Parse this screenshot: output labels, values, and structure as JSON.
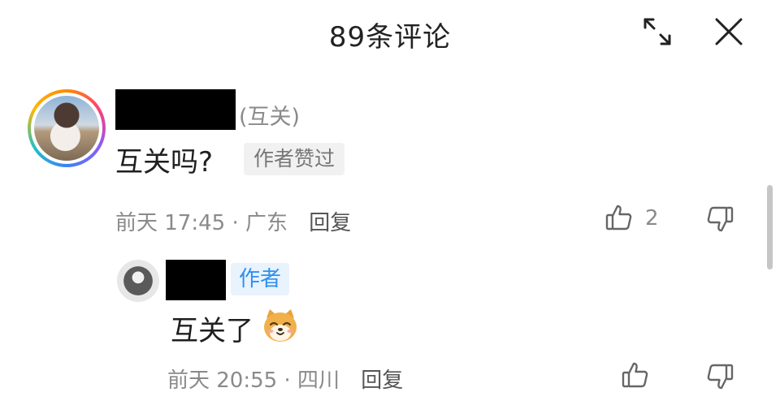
{
  "header": {
    "title": "89条评论",
    "expand_icon": "expand-icon",
    "close_icon": "close-icon"
  },
  "comment": {
    "relation": "(互关)",
    "text": "互关吗?",
    "liked_tag": "作者赞过",
    "time": "前天 17:45",
    "separator": "·",
    "location": "广东",
    "reply_label": "回复",
    "like_count": "2",
    "like_icon": "thumb-up-icon",
    "dislike_icon": "thumb-down-icon"
  },
  "reply": {
    "author_tag": "作者",
    "text": "互关了",
    "emoji_icon": "shiba-dog-emoji-icon",
    "time": "前天 20:55",
    "separator": "·",
    "location": "四川",
    "reply_label": "回复",
    "like_icon": "thumb-up-icon",
    "dislike_icon": "thumb-down-icon"
  },
  "colors": {
    "accent": "#2f8ff0",
    "tag_bg": "#e8f3fe",
    "muted": "#8a8a8a"
  }
}
